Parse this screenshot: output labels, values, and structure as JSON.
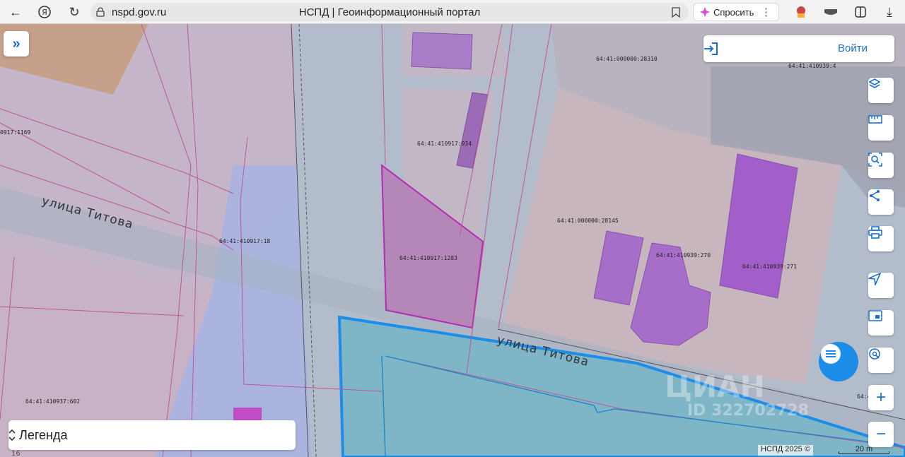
{
  "browser": {
    "url": "nspd.gov.ru",
    "title": "НСПД | Геоинформационный портал",
    "ask_label": "Спросить"
  },
  "map": {
    "parcels": [
      {
        "id": "p1169",
        "label": "0917:1169"
      },
      {
        "id": "p28310",
        "label": "64:41:000000:28310"
      },
      {
        "id": "p4",
        "label": "64:41:410939:4"
      },
      {
        "id": "p934",
        "label": "64:41:410917:934"
      },
      {
        "id": "p18",
        "label": "64:41:410917:18"
      },
      {
        "id": "p1283",
        "label": "64:41:410917:1283"
      },
      {
        "id": "p28145",
        "label": "64:41:000000:28145"
      },
      {
        "id": "p270",
        "label": "64:41:410939:270"
      },
      {
        "id": "p271",
        "label": "64:41:410939:271"
      },
      {
        "id": "p602",
        "label": "64:41:410937:602"
      },
      {
        "id": "p12",
        "label": "64:4"
      }
    ],
    "street_left": "улица Титова",
    "street_right": "улица Титова",
    "watermark_brand": "ЦИАН",
    "watermark_id": "ID 322702728",
    "copyright": "НСПД 2025 ©",
    "scale_label": "20 m",
    "tile_number": "16"
  },
  "controls": {
    "login_label": "Войти",
    "legend_label": "Легенда"
  },
  "colors": {
    "accent": "#1b6fd1",
    "parcel_line": "#c0569a",
    "building_fill": "#a55fc9",
    "selected_parcel": "#1c8de8"
  }
}
